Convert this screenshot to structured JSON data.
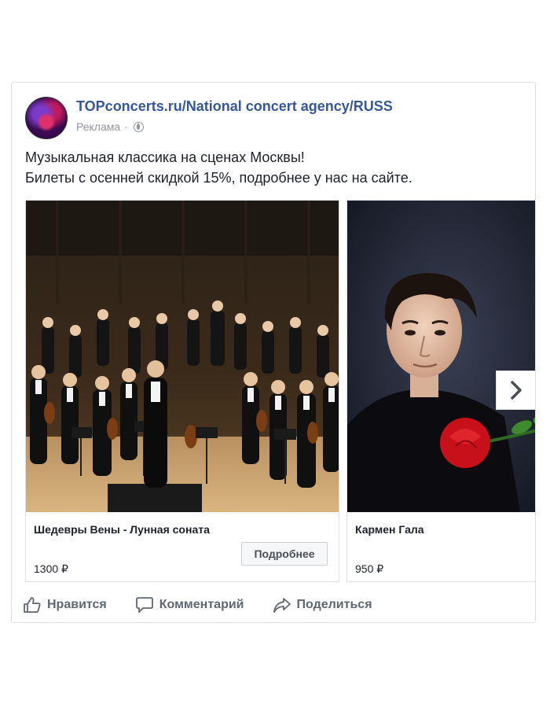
{
  "post": {
    "page_name": "TOPconcerts.ru/National concert agency/RUSS",
    "sponsored_label": "Реклама",
    "separator": "·",
    "text_lines": [
      "Музыкальная классика на сценах Москвы!",
      "Билеты с осенней скидкой 15%, подробнее у нас на сайте."
    ]
  },
  "carousel": {
    "cards": [
      {
        "title": "Шедевры Вены - Лунная соната",
        "price": "1300 ₽",
        "button": "Подробнее",
        "image": "orchestra-photo"
      },
      {
        "title": "Кармен Гала",
        "price": "950 ₽",
        "image": "singer-with-rose-photo"
      }
    ],
    "next_icon": "chevron-right-icon"
  },
  "actions": {
    "like": "Нравится",
    "comment": "Комментарий",
    "share": "Поделиться"
  },
  "colors": {
    "link": "#365899",
    "text": "#1d2129",
    "muted": "#90949c",
    "action": "#606770",
    "border": "#dddfe2"
  }
}
